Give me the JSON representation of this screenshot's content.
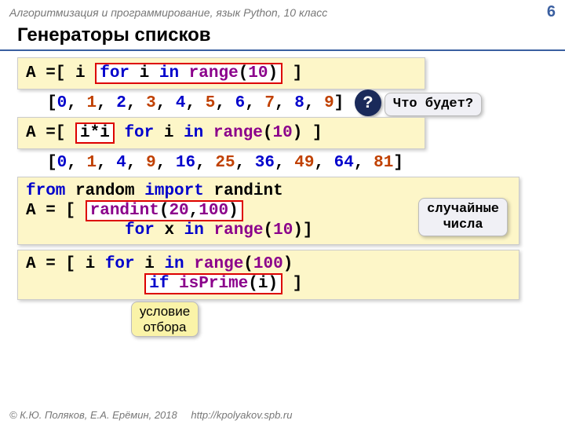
{
  "header": {
    "course": "Алгоритмизация и программирование, язык Python, 10 класс",
    "page": "6"
  },
  "title": "Генераторы списков",
  "block1": {
    "prefix": "A =[ i ",
    "boxed_for": "for",
    "boxed_mid": " i ",
    "boxed_in": "in",
    "boxed_sp": " ",
    "boxed_fn": "range",
    "boxed_paren": "(",
    "boxed_num": "10",
    "boxed_close": ")",
    "suffix": " ]"
  },
  "out1": "[0, 1, 2, 3, 4, 5, 6, 7, 8, 9]",
  "qbox": "Что будет?",
  "qmark": "?",
  "block2": {
    "prefix": "A =[ ",
    "boxed": "i*i",
    "mid1": " ",
    "for": "for",
    "mid2": " i ",
    "in": "in",
    "mid3": " ",
    "fn": "range",
    "paren": "(",
    "num": "10",
    "suffix": ") ]"
  },
  "out2": "[0, 1, 4, 9, 16, 25, 36, 49, 64, 81]",
  "block3": {
    "l1_from": "from",
    "l1_mid1": " random ",
    "l1_import": "import",
    "l1_mid2": " randint",
    "l2_prefix": "A = [ ",
    "l2_box_fn": "randint",
    "l2_box_paren1": "(",
    "l2_box_n1": "20",
    "l2_box_comma": ",",
    "l2_box_n2": "100",
    "l2_box_paren2": ")",
    "l3_prefix": "          ",
    "l3_for": "for",
    "l3_mid": " x ",
    "l3_in": "in",
    "l3_sp": " ",
    "l3_fn": "range",
    "l3_p1": "(",
    "l3_num": "10",
    "l3_suffix": ")]"
  },
  "callout_rand": "случайные\nчисла",
  "block4": {
    "l1_prefix": "A = [ i ",
    "l1_for": "for",
    "l1_mid": " i ",
    "l1_in": "in",
    "l1_sp": " ",
    "l1_fn": "range",
    "l1_p1": "(",
    "l1_num": "100",
    "l1_p2": ")",
    "l2_prefix": "            ",
    "l2_box_if": "if",
    "l2_box_sp": " ",
    "l2_box_fn": "isPrime",
    "l2_box_rest": "(i)",
    "l2_suffix": " ]"
  },
  "callout_filter": "условие\nотбора",
  "footer": {
    "copyright": "© К.Ю. Поляков, Е.А. Ерёмин, 2018",
    "link": "http://kpolyakov.spb.ru"
  }
}
